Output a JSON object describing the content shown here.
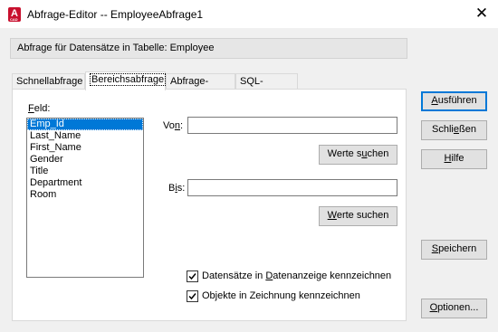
{
  "window": {
    "title": "Abfrage-Editor -- EmployeeAbfrage1",
    "close_glyph": "✕",
    "icon": "autocad-app-icon",
    "icon_letter": "A",
    "icon_sub": "CAD"
  },
  "info": {
    "text": "Abfrage für Datensätze in Tabelle:  Employee"
  },
  "tabs": [
    {
      "label": "Schnellabfrage",
      "active": false
    },
    {
      "label": "Bereichsabfrage",
      "active": true
    },
    {
      "label": "Abfrage-Editor",
      "active": false
    },
    {
      "label": "SQL-Abfrage",
      "active": false
    }
  ],
  "field": {
    "label": "Feld:",
    "items": [
      "Emp_Id",
      "Last_Name",
      "First_Name",
      "Gender",
      "Title",
      "Department",
      "Room"
    ],
    "selected": "Emp_Id"
  },
  "von": {
    "label": "Von:",
    "value": "",
    "search_label": "Werte suchen"
  },
  "bis": {
    "label": "Bis:",
    "value": "",
    "search_label": "Werte suchen"
  },
  "options": {
    "mark_records": {
      "label": "Datensätze in Datenanzeige kennzeichnen",
      "checked": true
    },
    "mark_objects": {
      "label": "Objekte in Zeichnung kennzeichnen",
      "checked": true
    }
  },
  "buttons": {
    "execute": "Ausführen",
    "close": "Schließen",
    "help": "Hilfe",
    "save": "Speichern",
    "options": "Optionen..."
  },
  "colors": {
    "accent": "#0078d7",
    "icon": "#c8102e"
  }
}
